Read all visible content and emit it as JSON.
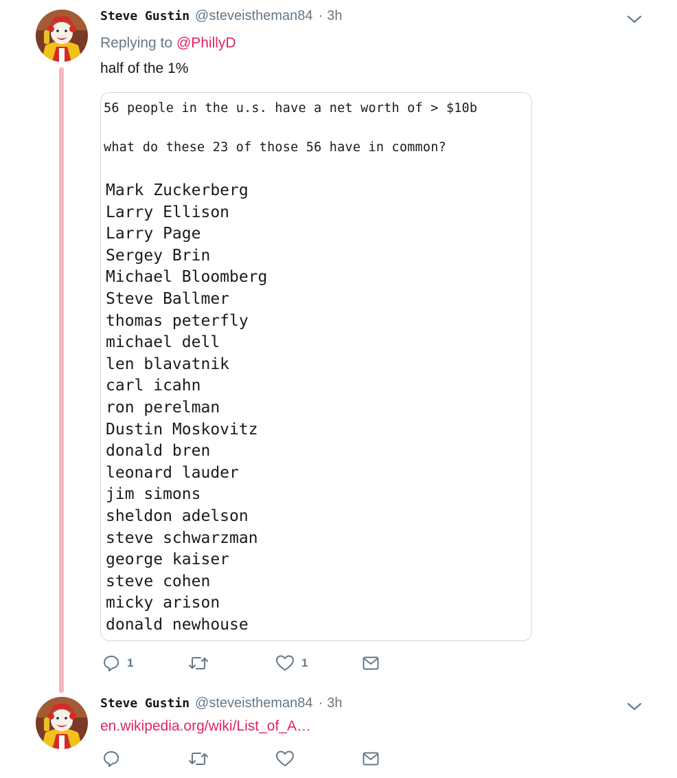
{
  "tweets": [
    {
      "author": {
        "display_name": "Steve Gustin",
        "handle": "@steveistheman84"
      },
      "separator": "·",
      "time": "3h",
      "replying_label": "Replying to",
      "replying_to": "@PhillyD",
      "text": "half of the 1%",
      "media": {
        "intro_line_1": "56 people in the u.s. have a net worth of > $10b",
        "intro_line_2": "what do these 23 of those 56 have in common?",
        "names": [
          "Mark Zuckerberg",
          "Larry Ellison",
          "Larry Page",
          "Sergey Brin",
          "Michael Bloomberg",
          "Steve Ballmer",
          "thomas peterfly",
          "michael dell",
          "len blavatnik",
          "carl icahn",
          "ron perelman",
          "Dustin Moskovitz",
          "donald bren",
          "leonard lauder",
          "jim simons",
          "sheldon adelson",
          "steve schwarzman",
          "george kaiser",
          "steve cohen",
          "micky arison",
          "donald newhouse"
        ]
      },
      "actions": {
        "reply_count": "1",
        "retweet_count": "",
        "like_count": "1"
      }
    },
    {
      "author": {
        "display_name": "Steve Gustin",
        "handle": "@steveistheman84"
      },
      "separator": "·",
      "time": "3h",
      "link_text": "en.wikipedia.org/wiki/List_of_A…",
      "actions": {
        "reply_count": "",
        "retweet_count": "",
        "like_count": ""
      }
    }
  ],
  "icons": {
    "reply": "reply-icon",
    "retweet": "retweet-icon",
    "like": "heart-icon",
    "dm": "envelope-icon",
    "more": "chevron-down-icon"
  },
  "colors": {
    "accent": "#e0245e",
    "thread_line": "#f4b6bf",
    "secondary_text": "#657786",
    "icon": "#657786"
  }
}
